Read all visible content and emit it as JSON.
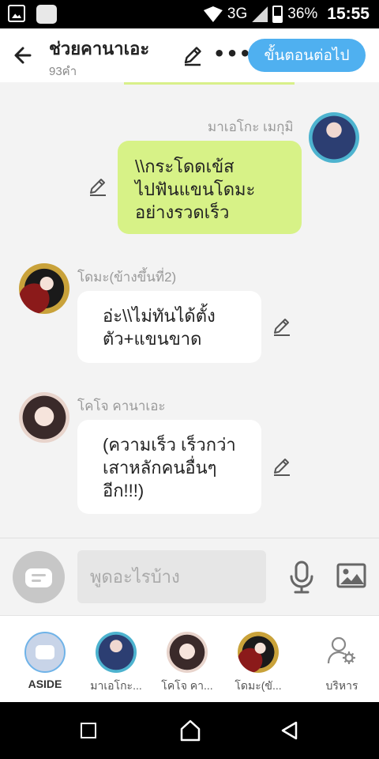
{
  "status_bar": {
    "network": "3G",
    "battery": "36%",
    "time": "15:55",
    "icons": [
      "gallery-icon",
      "app-icon",
      "wifi-icon",
      "signal-icon",
      "battery-icon"
    ]
  },
  "header": {
    "title": "ช่วยคานาเอะ",
    "word_count": "93คำ",
    "next_button": "ขั้นตอนต่อไป",
    "more_glyph": "•••"
  },
  "messages": [
    {
      "speaker": "มาเอโกะ เมกุมิ",
      "side": "right",
      "bubble_color": "#d7f287",
      "lines": [
        "\\\\กระโดดเข้ส",
        "ไปฟันแขนโดมะ",
        "อย่างรวดเร็ว"
      ]
    },
    {
      "speaker": "โดมะ(ข้างขึ้นที่2)",
      "side": "left",
      "bubble_color": "#ffffff",
      "lines": [
        "อ่ะ\\\\ไม่ทันได้ตั้ง",
        "ตัว+แขนขาด"
      ]
    },
    {
      "speaker": "โคโจ คานาเอะ",
      "side": "left",
      "bubble_color": "#ffffff",
      "lines": [
        "(ความเร็ว เร็วกว่า",
        "เสาหลักคนอื่นๆ",
        "อีก!!!)"
      ]
    }
  ],
  "input": {
    "placeholder": "พูดอะไรบ้าง"
  },
  "characters": [
    {
      "label": "ASIDE"
    },
    {
      "label": "มาเอโกะ..."
    },
    {
      "label": "โคโจ คา..."
    },
    {
      "label": "โดมะ(ขั..."
    },
    {
      "label": "บริหาร"
    }
  ],
  "colors": {
    "accent": "#4fb0f0",
    "own_bubble": "#d7f287",
    "chat_bg": "#f3f3f3"
  }
}
